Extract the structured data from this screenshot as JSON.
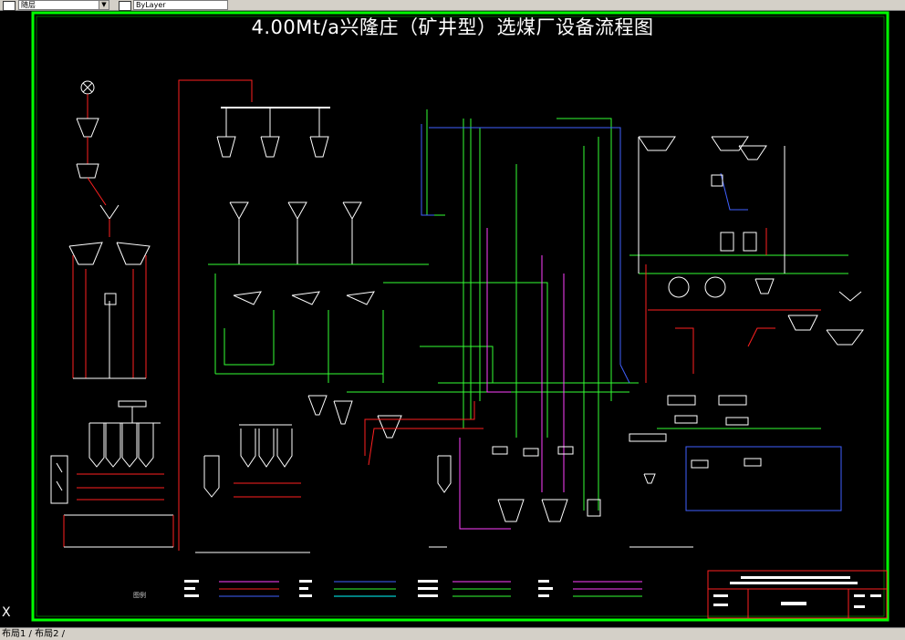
{
  "toolbar": {
    "layer_combo": "随层",
    "style_combo": "ByLayer"
  },
  "drawing": {
    "title": "4.00Mt/a兴隆庄（矿井型）选煤厂设备流程图",
    "legend_label": "图例",
    "colors": {
      "frame": "#00ff00",
      "pipe_white": "#ffffff",
      "pipe_red": "#ff2020",
      "pipe_green": "#33ff33",
      "pipe_blue": "#4060ff",
      "pipe_magenta": "#ff40ff",
      "pipe_cyan": "#00ffff",
      "border": "#ff2020"
    }
  },
  "status": {
    "tabs": "布局1 / 布局2 /"
  },
  "axis": {
    "x_label": "X"
  }
}
